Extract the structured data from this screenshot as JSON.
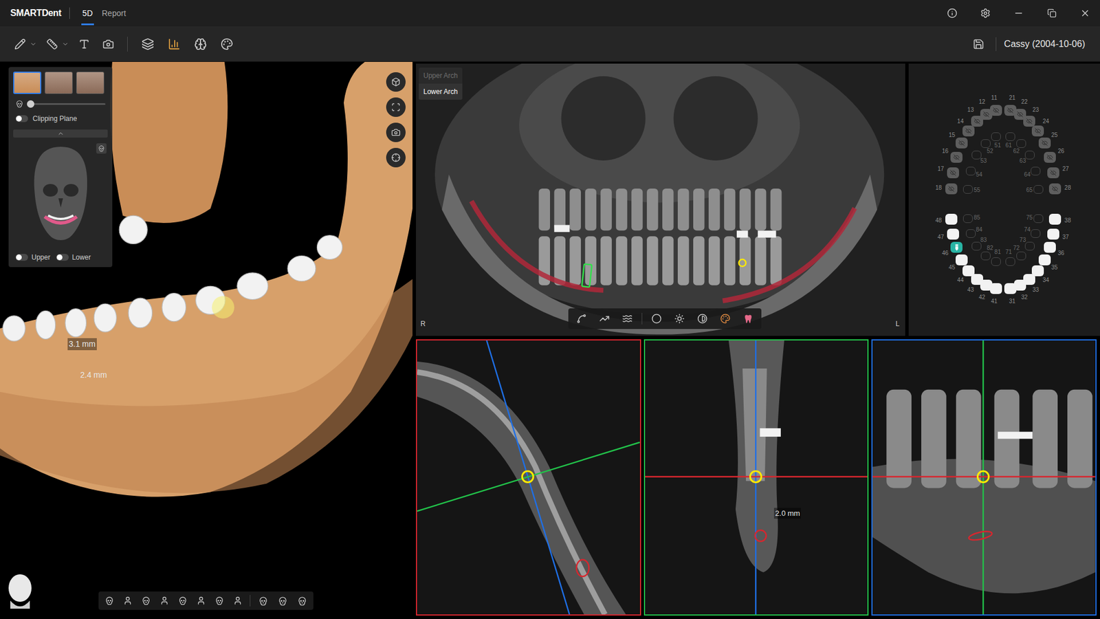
{
  "window": {
    "logo": "SMARTDent"
  },
  "tabs": [
    {
      "label": "5D",
      "selected": true
    },
    {
      "label": "Report",
      "selected": false
    }
  ],
  "patient": {
    "name": "Cassy (2004-10-06)"
  },
  "view3d": {
    "thumbnails": [
      {
        "selected": true
      },
      {
        "selected": false
      },
      {
        "selected": false
      }
    ],
    "opacity": {
      "level": 0.0
    },
    "clipping_plane": {
      "label": "Clipping Plane",
      "on": false
    },
    "jaw_toggles": [
      {
        "label": "Upper",
        "on": false
      },
      {
        "label": "Lower",
        "on": false
      }
    ],
    "measurements": [
      "3.1 mm",
      "2.4 mm"
    ]
  },
  "panorama": {
    "arches": [
      {
        "label": "Upper Arch",
        "selected": false
      },
      {
        "label": "Lower Arch",
        "selected": true
      }
    ],
    "side_labels": [
      "R",
      "L"
    ]
  },
  "slices": [
    {
      "kind": "axial",
      "color": "#d8262e"
    },
    {
      "kind": "cross",
      "color": "#22c24a",
      "measurement": "2.0 mm"
    },
    {
      "kind": "tangential",
      "color": "#1f6fe5"
    }
  ],
  "tooth_chart": {
    "teeth": [
      {
        "number": "11",
        "kind": "permanent",
        "hidden": true,
        "selected": false
      },
      {
        "number": "12",
        "kind": "permanent",
        "hidden": true,
        "selected": false
      },
      {
        "number": "13",
        "kind": "permanent",
        "hidden": true,
        "selected": false
      },
      {
        "number": "14",
        "kind": "permanent",
        "hidden": true,
        "selected": false
      },
      {
        "number": "15",
        "kind": "permanent",
        "hidden": true,
        "selected": false
      },
      {
        "number": "16",
        "kind": "permanent",
        "hidden": true,
        "selected": false
      },
      {
        "number": "17",
        "kind": "permanent",
        "hidden": true,
        "selected": false
      },
      {
        "number": "18",
        "kind": "permanent",
        "hidden": true,
        "selected": false
      },
      {
        "number": "21",
        "kind": "permanent",
        "hidden": true,
        "selected": false
      },
      {
        "number": "22",
        "kind": "permanent",
        "hidden": true,
        "selected": false
      },
      {
        "number": "23",
        "kind": "permanent",
        "hidden": true,
        "selected": false
      },
      {
        "number": "24",
        "kind": "permanent",
        "hidden": true,
        "selected": false
      },
      {
        "number": "25",
        "kind": "permanent",
        "hidden": true,
        "selected": false
      },
      {
        "number": "26",
        "kind": "permanent",
        "hidden": true,
        "selected": false
      },
      {
        "number": "27",
        "kind": "permanent",
        "hidden": true,
        "selected": false
      },
      {
        "number": "28",
        "kind": "permanent",
        "hidden": true,
        "selected": false
      },
      {
        "number": "51",
        "kind": "primary",
        "hidden": false,
        "selected": false
      },
      {
        "number": "52",
        "kind": "primary",
        "hidden": false,
        "selected": false
      },
      {
        "number": "53",
        "kind": "primary",
        "hidden": false,
        "selected": false
      },
      {
        "number": "54",
        "kind": "primary",
        "hidden": false,
        "selected": false
      },
      {
        "number": "55",
        "kind": "primary",
        "hidden": false,
        "selected": false
      },
      {
        "number": "61",
        "kind": "primary",
        "hidden": false,
        "selected": false
      },
      {
        "number": "62",
        "kind": "primary",
        "hidden": false,
        "selected": false
      },
      {
        "number": "63",
        "kind": "primary",
        "hidden": false,
        "selected": false
      },
      {
        "number": "64",
        "kind": "primary",
        "hidden": false,
        "selected": false
      },
      {
        "number": "65",
        "kind": "primary",
        "hidden": false,
        "selected": false
      },
      {
        "number": "31",
        "kind": "permanent",
        "hidden": false,
        "selected": false
      },
      {
        "number": "32",
        "kind": "permanent",
        "hidden": false,
        "selected": false
      },
      {
        "number": "33",
        "kind": "permanent",
        "hidden": false,
        "selected": false
      },
      {
        "number": "34",
        "kind": "permanent",
        "hidden": false,
        "selected": false
      },
      {
        "number": "35",
        "kind": "permanent",
        "hidden": false,
        "selected": false
      },
      {
        "number": "36",
        "kind": "permanent",
        "hidden": false,
        "selected": false
      },
      {
        "number": "37",
        "kind": "permanent",
        "hidden": false,
        "selected": false
      },
      {
        "number": "38",
        "kind": "permanent",
        "hidden": false,
        "selected": false
      },
      {
        "number": "41",
        "kind": "permanent",
        "hidden": false,
        "selected": false
      },
      {
        "number": "42",
        "kind": "permanent",
        "hidden": false,
        "selected": false
      },
      {
        "number": "43",
        "kind": "permanent",
        "hidden": false,
        "selected": false
      },
      {
        "number": "44",
        "kind": "permanent",
        "hidden": false,
        "selected": false
      },
      {
        "number": "45",
        "kind": "permanent",
        "hidden": false,
        "selected": false
      },
      {
        "number": "46",
        "kind": "permanent",
        "hidden": false,
        "selected": true
      },
      {
        "number": "47",
        "kind": "permanent",
        "hidden": false,
        "selected": false
      },
      {
        "number": "48",
        "kind": "permanent",
        "hidden": false,
        "selected": false
      },
      {
        "number": "71",
        "kind": "primary",
        "hidden": false,
        "selected": false
      },
      {
        "number": "72",
        "kind": "primary",
        "hidden": false,
        "selected": false
      },
      {
        "number": "73",
        "kind": "primary",
        "hidden": false,
        "selected": false
      },
      {
        "number": "74",
        "kind": "primary",
        "hidden": false,
        "selected": false
      },
      {
        "number": "75",
        "kind": "primary",
        "hidden": false,
        "selected": false
      },
      {
        "number": "81",
        "kind": "primary",
        "hidden": false,
        "selected": false
      },
      {
        "number": "82",
        "kind": "primary",
        "hidden": false,
        "selected": false
      },
      {
        "number": "83",
        "kind": "primary",
        "hidden": false,
        "selected": false
      },
      {
        "number": "84",
        "kind": "primary",
        "hidden": false,
        "selected": false
      },
      {
        "number": "85",
        "kind": "primary",
        "hidden": false,
        "selected": false
      }
    ]
  }
}
